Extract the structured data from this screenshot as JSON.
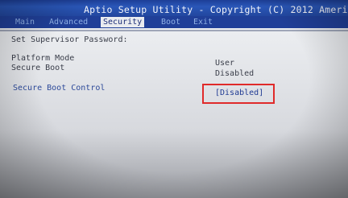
{
  "header": {
    "title": "Aptio Setup Utility - Copyright (C) 2012 Americ"
  },
  "tabs": [
    {
      "label": "Main",
      "active": false
    },
    {
      "label": "Advanced",
      "active": false
    },
    {
      "label": "Security",
      "active": true
    },
    {
      "label": "Boot",
      "active": false
    },
    {
      "label": "Exit",
      "active": false
    }
  ],
  "security": {
    "supervisor_password_label": "Set Supervisor Password:",
    "platform_mode_label": "Platform Mode",
    "platform_mode_value": "User",
    "secure_boot_label": "Secure Boot",
    "secure_boot_value": "Disabled",
    "secure_boot_control_label": "Secure Boot Control",
    "secure_boot_control_value": "[Disabled]"
  },
  "colors": {
    "title_bar": "#2a57b8",
    "tab_bar": "#203f98",
    "active_tab_bg": "#e9ebef",
    "content_bg": "#eceef1",
    "highlight_border": "#e02a2a"
  }
}
